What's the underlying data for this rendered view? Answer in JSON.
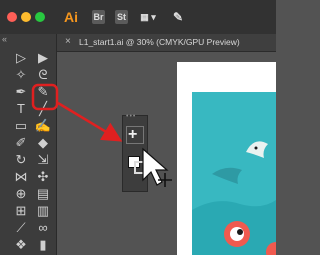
{
  "window": {
    "app_name": "Ai",
    "traffic_lights": {
      "close": "#ff5f57",
      "minimize": "#febc2e",
      "zoom": "#28c840"
    }
  },
  "titlebar": {
    "buttons": [
      {
        "label": "Br",
        "name": "bridge-button"
      },
      {
        "label": "St",
        "name": "stock-button"
      },
      {
        "label": "▦ ▾",
        "name": "arrange-documents-button"
      },
      {
        "label": "✎",
        "name": "gpu-performance-icon"
      }
    ]
  },
  "document_tab": {
    "close_glyph": "×",
    "label": "L1_start1.ai @ 30% (CMYK/GPU Preview)"
  },
  "toolbar": {
    "collapse_glyph": "«",
    "tools": [
      {
        "name": "selection-tool-icon",
        "glyph": "▷"
      },
      {
        "name": "direct-selection-tool-icon",
        "glyph": "▶"
      },
      {
        "name": "magic-wand-tool-icon",
        "glyph": "✧"
      },
      {
        "name": "lasso-tool-icon",
        "glyph": "ᘓ"
      },
      {
        "name": "pen-tool-icon",
        "glyph": "✒"
      },
      {
        "name": "pencil-tool-icon",
        "glyph": "✎"
      },
      {
        "name": "type-tool-icon",
        "glyph": "T"
      },
      {
        "name": "line-segment-tool-icon",
        "glyph": "╱"
      },
      {
        "name": "rectangle-tool-icon",
        "glyph": "▭"
      },
      {
        "name": "paintbrush-tool-icon",
        "glyph": "✍"
      },
      {
        "name": "shaper-tool-icon",
        "glyph": "✐"
      },
      {
        "name": "eraser-tool-icon",
        "glyph": "◆"
      },
      {
        "name": "rotate-tool-icon",
        "glyph": "↻"
      },
      {
        "name": "scale-tool-icon",
        "glyph": "⇲"
      },
      {
        "name": "width-tool-icon",
        "glyph": "⋈"
      },
      {
        "name": "puppet-warp-tool-icon",
        "glyph": "✣"
      },
      {
        "name": "shape-builder-tool-icon",
        "glyph": "⊕"
      },
      {
        "name": "perspective-grid-tool-icon",
        "glyph": "▤"
      },
      {
        "name": "mesh-tool-icon",
        "glyph": "⊞"
      },
      {
        "name": "gradient-tool-icon",
        "glyph": "▥"
      },
      {
        "name": "eyedropper-tool-icon",
        "glyph": "⟋"
      },
      {
        "name": "blend-tool-icon",
        "glyph": "∞"
      },
      {
        "name": "symbol-sprayer-tool-icon",
        "glyph": "❖"
      },
      {
        "name": "column-graph-tool-icon",
        "glyph": "▮"
      }
    ],
    "highlight_color": "#e02020"
  },
  "floating_toolbar": {
    "add_glyph": "+",
    "more_glyph": "•••"
  },
  "colors": {
    "app_dark": "#323232",
    "toolbar_bg": "#3c3c3c",
    "canvas_bg": "#535353",
    "artwork_teal": "#38b8c1",
    "annotation_red": "#e02020"
  }
}
